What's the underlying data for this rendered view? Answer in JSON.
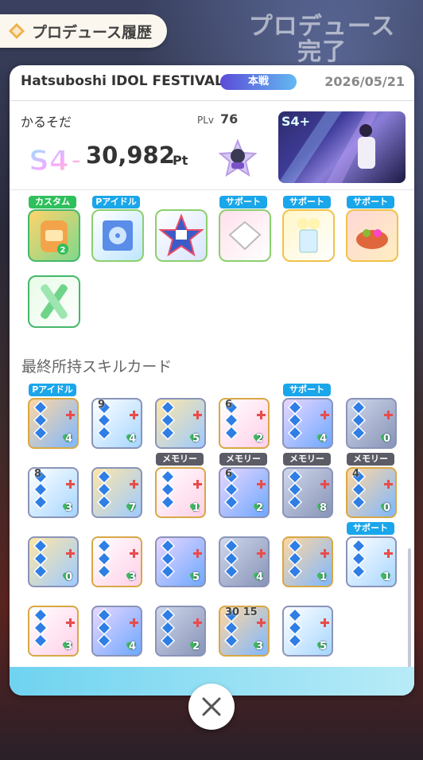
{
  "header": {
    "history_label": "プロデュース履歴",
    "background_text": "プロデュース\n完了"
  },
  "panel": {
    "event_title": "Hatsuboshi IDOL FESTIVAL",
    "stage_badge": "本戦",
    "date": "2026/05/21",
    "idol_name": "かるそだ",
    "plv_label": "PLv",
    "plv_value": "76",
    "rank_badge": "S4+",
    "score": "30,982",
    "score_unit": "Pt"
  },
  "items": {
    "tags": [
      "カスタム",
      "Pアイドル",
      "サポート",
      "サポート",
      "サポート"
    ],
    "custom_count": "2"
  },
  "skill_cards": {
    "section_title": "最終所持スキルカード",
    "tags": {
      "p_idol": "Pアイドル",
      "support": "サポート",
      "memory": "メモリー"
    },
    "rows": [
      [
        {
          "cost": "",
          "count": "4"
        },
        {
          "cost": "9",
          "count": "4"
        },
        {
          "cost": "",
          "count": "5"
        },
        {
          "cost": "6",
          "count": "2"
        },
        {
          "cost": "",
          "count": "4"
        },
        {
          "cost": "",
          "count": "0"
        }
      ],
      [
        {
          "cost": "8",
          "count": "3"
        },
        {
          "cost": "",
          "count": "7"
        },
        {
          "cost": "",
          "count": "1"
        },
        {
          "cost": "6",
          "count": "2"
        },
        {
          "cost": "",
          "count": "8"
        },
        {
          "cost": "4",
          "count": "0"
        }
      ],
      [
        {
          "cost": "",
          "count": "0"
        },
        {
          "cost": "",
          "count": "3"
        },
        {
          "cost": "",
          "count": "5"
        },
        {
          "cost": "",
          "count": "4"
        },
        {
          "cost": "",
          "count": "1"
        },
        {
          "cost": "",
          "count": "1"
        }
      ],
      [
        {
          "cost": "",
          "count": "3"
        },
        {
          "cost": "",
          "count": "4"
        },
        {
          "cost": "",
          "count": "2"
        },
        {
          "cost": "30 15",
          "count": "3"
        },
        {
          "cost": "",
          "count": "5"
        }
      ]
    ]
  },
  "colors": {
    "accent_blue": "#1aa6ea",
    "accent_green": "#2fbf5c",
    "memory_gray": "#5c5c66"
  }
}
